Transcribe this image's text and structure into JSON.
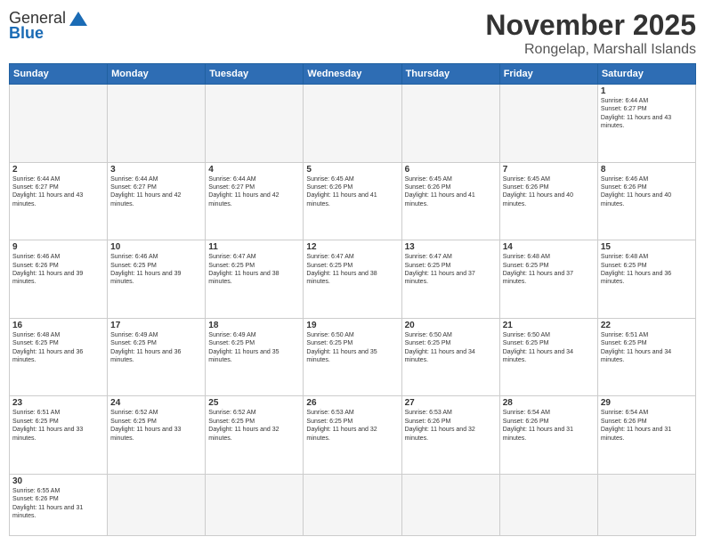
{
  "header": {
    "logo_general": "General",
    "logo_blue": "Blue",
    "month_title": "November 2025",
    "location": "Rongelap, Marshall Islands"
  },
  "weekdays": [
    "Sunday",
    "Monday",
    "Tuesday",
    "Wednesday",
    "Thursday",
    "Friday",
    "Saturday"
  ],
  "weeks": [
    [
      {
        "day": "",
        "empty": true
      },
      {
        "day": "",
        "empty": true
      },
      {
        "day": "",
        "empty": true
      },
      {
        "day": "",
        "empty": true
      },
      {
        "day": "",
        "empty": true
      },
      {
        "day": "",
        "empty": true
      },
      {
        "day": "1",
        "sunrise": "6:44 AM",
        "sunset": "6:27 PM",
        "daylight": "11 hours and 43 minutes."
      }
    ],
    [
      {
        "day": "2",
        "sunrise": "6:44 AM",
        "sunset": "6:27 PM",
        "daylight": "11 hours and 43 minutes."
      },
      {
        "day": "3",
        "sunrise": "6:44 AM",
        "sunset": "6:27 PM",
        "daylight": "11 hours and 42 minutes."
      },
      {
        "day": "4",
        "sunrise": "6:44 AM",
        "sunset": "6:27 PM",
        "daylight": "11 hours and 42 minutes."
      },
      {
        "day": "5",
        "sunrise": "6:45 AM",
        "sunset": "6:26 PM",
        "daylight": "11 hours and 41 minutes."
      },
      {
        "day": "6",
        "sunrise": "6:45 AM",
        "sunset": "6:26 PM",
        "daylight": "11 hours and 41 minutes."
      },
      {
        "day": "7",
        "sunrise": "6:45 AM",
        "sunset": "6:26 PM",
        "daylight": "11 hours and 40 minutes."
      },
      {
        "day": "8",
        "sunrise": "6:46 AM",
        "sunset": "6:26 PM",
        "daylight": "11 hours and 40 minutes."
      }
    ],
    [
      {
        "day": "9",
        "sunrise": "6:46 AM",
        "sunset": "6:26 PM",
        "daylight": "11 hours and 39 minutes."
      },
      {
        "day": "10",
        "sunrise": "6:46 AM",
        "sunset": "6:25 PM",
        "daylight": "11 hours and 39 minutes."
      },
      {
        "day": "11",
        "sunrise": "6:47 AM",
        "sunset": "6:25 PM",
        "daylight": "11 hours and 38 minutes."
      },
      {
        "day": "12",
        "sunrise": "6:47 AM",
        "sunset": "6:25 PM",
        "daylight": "11 hours and 38 minutes."
      },
      {
        "day": "13",
        "sunrise": "6:47 AM",
        "sunset": "6:25 PM",
        "daylight": "11 hours and 37 minutes."
      },
      {
        "day": "14",
        "sunrise": "6:48 AM",
        "sunset": "6:25 PM",
        "daylight": "11 hours and 37 minutes."
      },
      {
        "day": "15",
        "sunrise": "6:48 AM",
        "sunset": "6:25 PM",
        "daylight": "11 hours and 36 minutes."
      }
    ],
    [
      {
        "day": "16",
        "sunrise": "6:48 AM",
        "sunset": "6:25 PM",
        "daylight": "11 hours and 36 minutes."
      },
      {
        "day": "17",
        "sunrise": "6:49 AM",
        "sunset": "6:25 PM",
        "daylight": "11 hours and 36 minutes."
      },
      {
        "day": "18",
        "sunrise": "6:49 AM",
        "sunset": "6:25 PM",
        "daylight": "11 hours and 35 minutes."
      },
      {
        "day": "19",
        "sunrise": "6:50 AM",
        "sunset": "6:25 PM",
        "daylight": "11 hours and 35 minutes."
      },
      {
        "day": "20",
        "sunrise": "6:50 AM",
        "sunset": "6:25 PM",
        "daylight": "11 hours and 34 minutes."
      },
      {
        "day": "21",
        "sunrise": "6:50 AM",
        "sunset": "6:25 PM",
        "daylight": "11 hours and 34 minutes."
      },
      {
        "day": "22",
        "sunrise": "6:51 AM",
        "sunset": "6:25 PM",
        "daylight": "11 hours and 34 minutes."
      }
    ],
    [
      {
        "day": "23",
        "sunrise": "6:51 AM",
        "sunset": "6:25 PM",
        "daylight": "11 hours and 33 minutes."
      },
      {
        "day": "24",
        "sunrise": "6:52 AM",
        "sunset": "6:25 PM",
        "daylight": "11 hours and 33 minutes."
      },
      {
        "day": "25",
        "sunrise": "6:52 AM",
        "sunset": "6:25 PM",
        "daylight": "11 hours and 32 minutes."
      },
      {
        "day": "26",
        "sunrise": "6:53 AM",
        "sunset": "6:25 PM",
        "daylight": "11 hours and 32 minutes."
      },
      {
        "day": "27",
        "sunrise": "6:53 AM",
        "sunset": "6:26 PM",
        "daylight": "11 hours and 32 minutes."
      },
      {
        "day": "28",
        "sunrise": "6:54 AM",
        "sunset": "6:26 PM",
        "daylight": "11 hours and 31 minutes."
      },
      {
        "day": "29",
        "sunrise": "6:54 AM",
        "sunset": "6:26 PM",
        "daylight": "11 hours and 31 minutes."
      }
    ],
    [
      {
        "day": "30",
        "sunrise": "6:55 AM",
        "sunset": "6:26 PM",
        "daylight": "11 hours and 31 minutes.",
        "last": true
      },
      {
        "day": "",
        "empty": true,
        "last": true
      },
      {
        "day": "",
        "empty": true,
        "last": true
      },
      {
        "day": "",
        "empty": true,
        "last": true
      },
      {
        "day": "",
        "empty": true,
        "last": true
      },
      {
        "day": "",
        "empty": true,
        "last": true
      },
      {
        "day": "",
        "empty": true,
        "last": true
      }
    ]
  ]
}
